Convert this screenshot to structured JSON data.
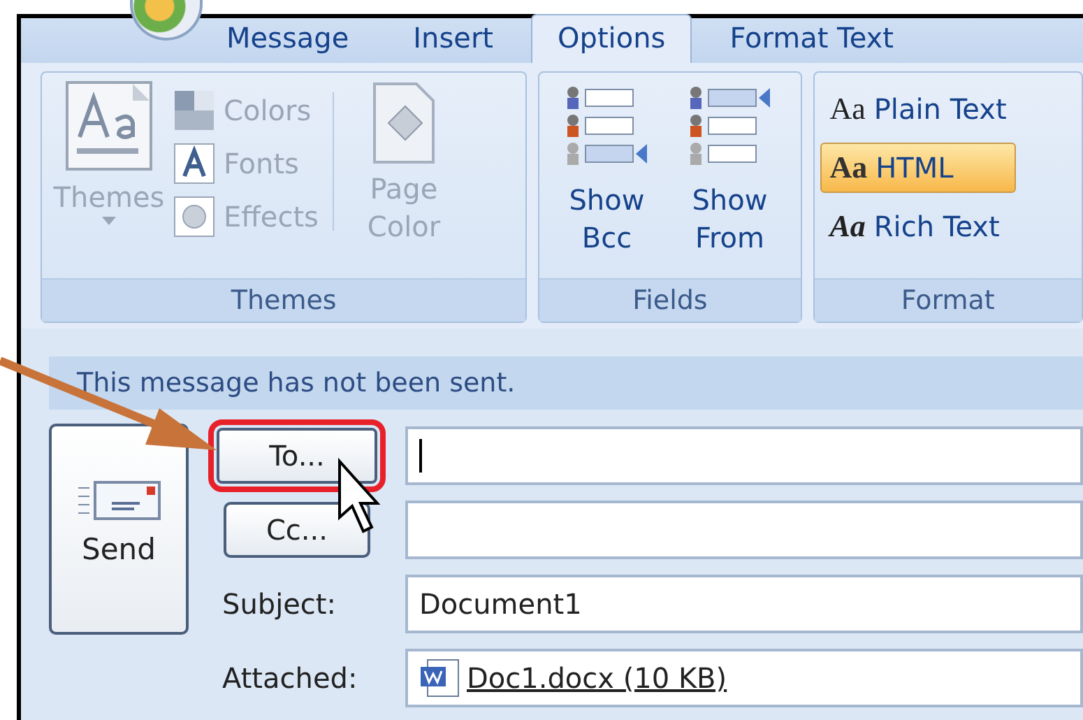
{
  "tabs": [
    {
      "label": "Message",
      "selected": false
    },
    {
      "label": "Insert",
      "selected": false
    },
    {
      "label": "Options",
      "selected": true
    },
    {
      "label": "Format Text",
      "selected": false
    }
  ],
  "themes_group": {
    "label": "Themes",
    "themes_button": {
      "label": "Themes",
      "disabled": true
    },
    "small_buttons": [
      {
        "label": "Colors",
        "disabled": true
      },
      {
        "label": "Fonts",
        "disabled": true
      },
      {
        "label": "Effects",
        "disabled": true
      }
    ],
    "page_color": {
      "label": "Page Color",
      "disabled": true
    }
  },
  "fields_group": {
    "label": "Fields",
    "buttons": [
      {
        "label": "Show Bcc"
      },
      {
        "label": "Show From"
      }
    ]
  },
  "format_group": {
    "label": "Format",
    "options": [
      {
        "glyph": "Aa",
        "label": "Plain Text",
        "selected": false
      },
      {
        "glyph": "Aa",
        "label": "HTML",
        "selected": true
      },
      {
        "glyph": "Aa",
        "label": "Rich Text",
        "selected": false
      }
    ]
  },
  "info_bar": "This message has not been sent.",
  "compose": {
    "send_button": "Send",
    "to_button": {
      "label": "To...",
      "highlighted": true
    },
    "cc_button": {
      "label": "Cc...",
      "highlighted": false
    },
    "subject": {
      "label": "Subject:",
      "value": "Document1"
    },
    "attached": {
      "label": "Attached:",
      "file": "Doc1.docx (10 KB)"
    }
  }
}
